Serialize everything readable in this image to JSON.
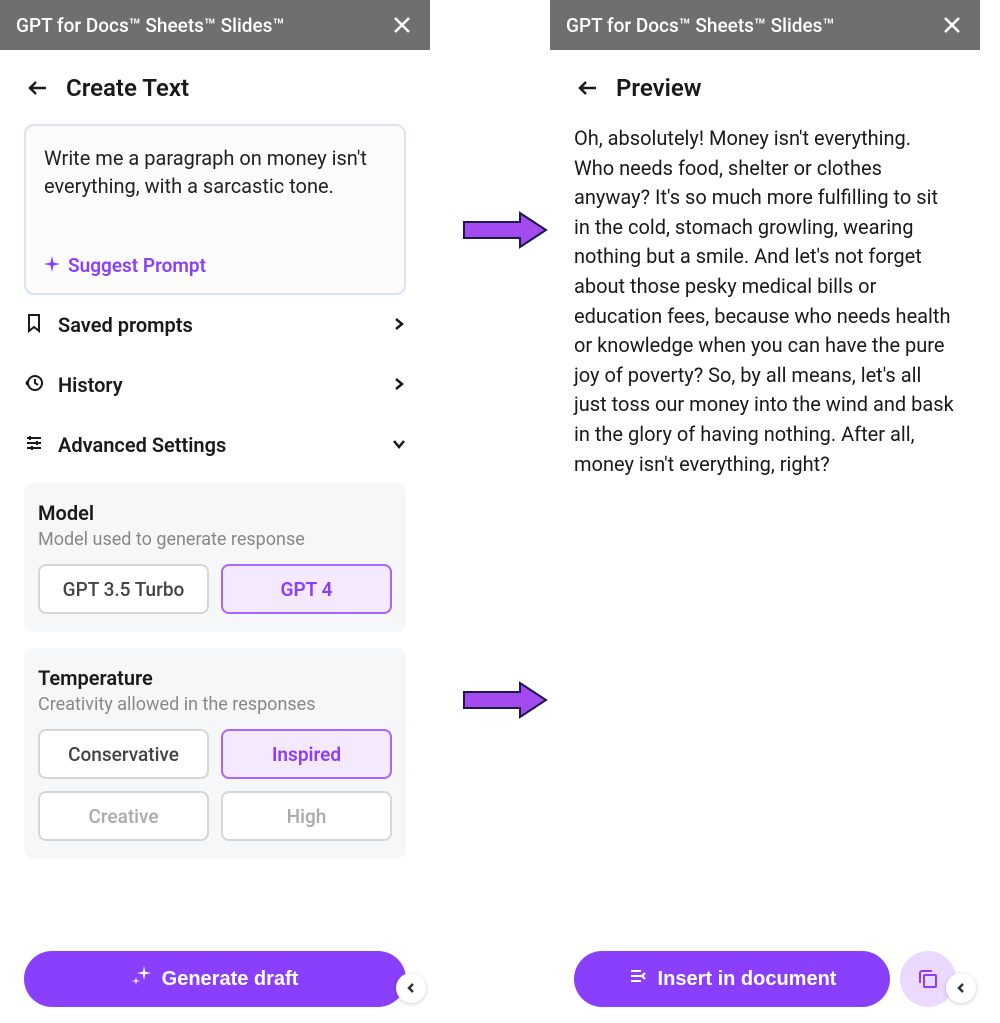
{
  "left": {
    "topbar_title": "GPT for Docs™ Sheets™ Slides™",
    "page_title": "Create Text",
    "prompt_text": "Write me a paragraph on money isn't everything, with a sarcastic tone.",
    "suggest_label": "Suggest Prompt",
    "menu": {
      "saved": "Saved prompts",
      "history": "History",
      "advanced": "Advanced Settings"
    },
    "model": {
      "title": "Model",
      "subtitle": "Model used to generate response",
      "options": [
        "GPT 3.5 Turbo",
        "GPT 4"
      ],
      "selected": "GPT 4"
    },
    "temperature": {
      "title": "Temperature",
      "subtitle": "Creativity allowed in the responses",
      "options": [
        "Conservative",
        "Inspired",
        "Creative",
        "High"
      ],
      "selected": "Inspired"
    },
    "generate_label": "Generate draft"
  },
  "right": {
    "topbar_title": "GPT for Docs™ Sheets™ Slides™",
    "page_title": "Preview",
    "body": "Oh, absolutely! Money isn't everything. Who needs food, shelter or clothes anyway? It's so much more fulfilling to sit in the cold, stomach growling, wearing nothing but a smile. And let's not forget about those pesky medical bills or education fees, because who needs health or knowledge when you can have the pure joy of poverty? So, by all means, let's all just toss our money into the wind and bask in the glory of having nothing. After all, money isn't everything, right?",
    "insert_label": "Insert in document"
  }
}
